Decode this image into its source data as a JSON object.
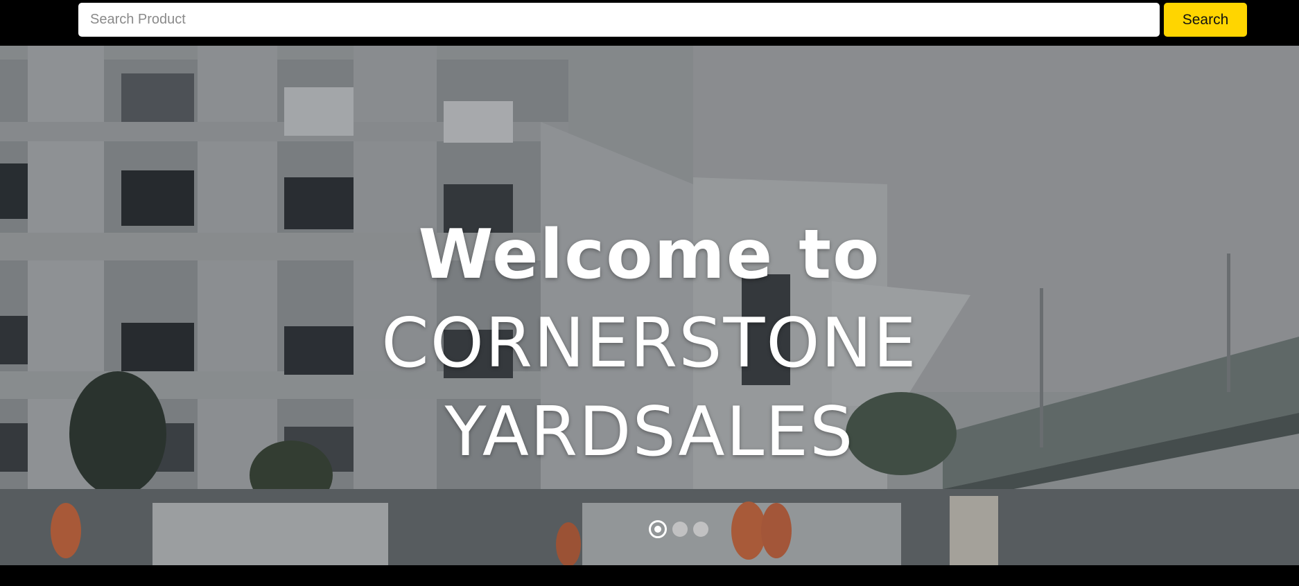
{
  "search": {
    "placeholder": "Search Product",
    "value": "",
    "button_label": "Search",
    "button_color": "#ffd500"
  },
  "hero": {
    "heading_line1": "Welcome to",
    "heading_line2": "CORNERSTONE",
    "heading_line3": "YARDSALES",
    "slides": {
      "count": 3,
      "active_index": 0
    }
  }
}
